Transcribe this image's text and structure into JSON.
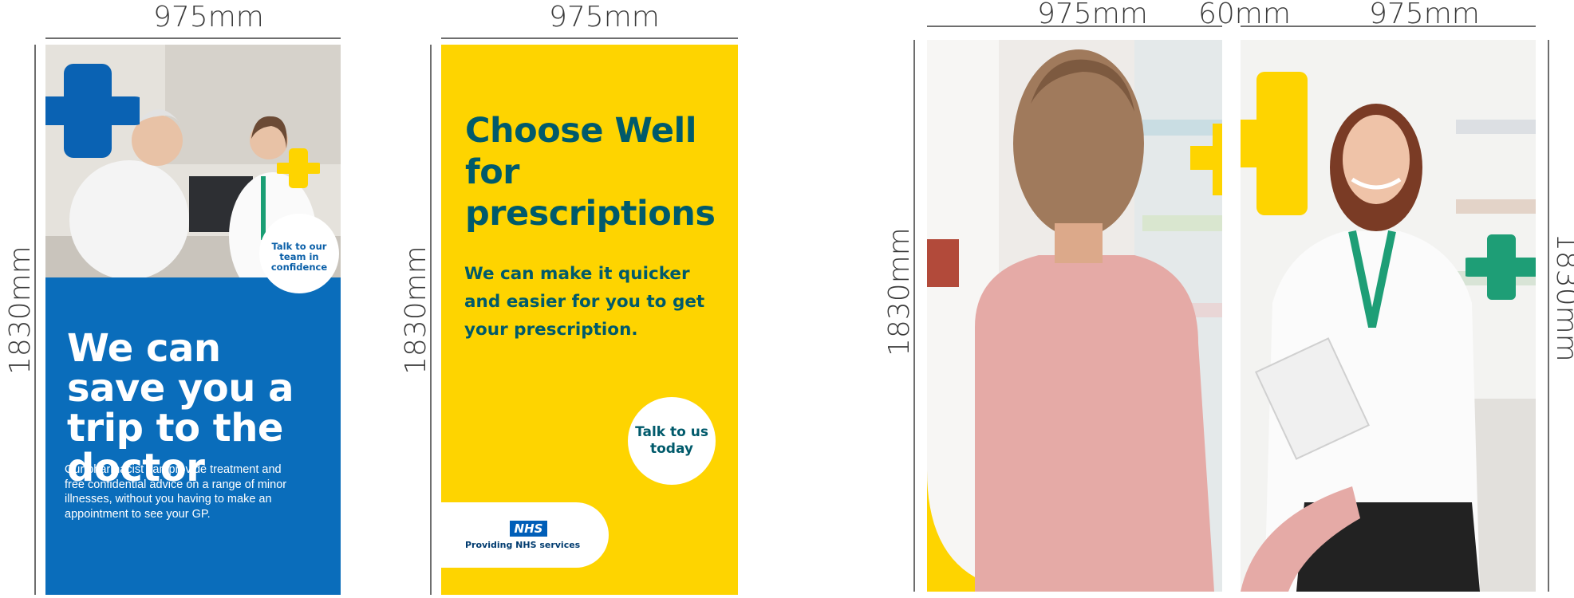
{
  "dimensions": {
    "panel1_width": "975mm",
    "panel1_height": "1830mm",
    "panel2_width": "975mm",
    "panel2_height": "1830mm",
    "panel3_width": "975mm",
    "gap": "60mm",
    "panel4_width": "975mm",
    "panel3_height": "1830mm",
    "panel4_height": "1830mm"
  },
  "panel1": {
    "headline": "We can save you a trip to the doctor",
    "body": "Our pharmacist can provide treatment and free confidential advice on a range of minor illnesses, without you having to make an appointment to see your GP.",
    "bubble": "Talk to our team in confidence"
  },
  "panel2": {
    "headline": "Choose Well for prescriptions",
    "body": "We can make it quicker and easier for you to get your prescription.",
    "bubble": "Talk to us today",
    "nhs_logo": "NHS",
    "nhs_text": "Providing NHS services"
  },
  "colors": {
    "blue": "#0a6dbb",
    "yellow": "#fed400",
    "teal_text": "#005a6b",
    "green_cross": "#1e9e76",
    "nhs_blue": "#005eb8"
  },
  "icons": {
    "panel1": [
      "cross-icon",
      "cross-icon"
    ],
    "panel3": [
      "cross-icon"
    ],
    "panel4": [
      "cross-icon",
      "cross-icon"
    ]
  }
}
